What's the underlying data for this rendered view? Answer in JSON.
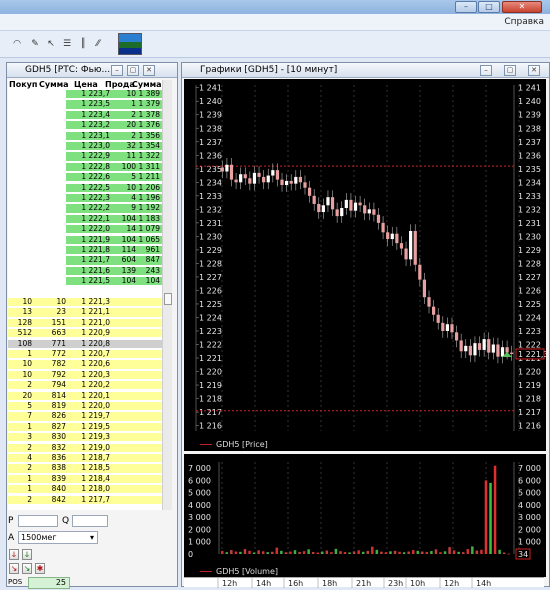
{
  "menu": {
    "help": "Справка"
  },
  "orderbook": {
    "title": "GDH5 [РТС: Фью...",
    "columns": [
      "Покуп",
      "Сумма",
      "Цена",
      "Прода",
      "Сумма"
    ],
    "rows": [
      [
        "",
        "",
        "1 223,7",
        "10",
        "1 389"
      ],
      [
        "",
        "",
        "1 223,5",
        "1",
        "1 379"
      ],
      [
        "",
        "",
        "1 223,4",
        "2",
        "1 378"
      ],
      [
        "",
        "",
        "1 223,2",
        "20",
        "1 376"
      ],
      [
        "",
        "",
        "1 223,1",
        "2",
        "1 356"
      ],
      [
        "",
        "",
        "1 223,0",
        "32",
        "1 354"
      ],
      [
        "",
        "",
        "1 222,9",
        "11",
        "1 322"
      ],
      [
        "",
        "",
        "1 222,8",
        "100",
        "1 311"
      ],
      [
        "",
        "",
        "1 222,6",
        "5",
        "1 211"
      ],
      [
        "",
        "",
        "1 222,5",
        "10",
        "1 206"
      ],
      [
        "",
        "",
        "1 222,3",
        "4",
        "1 196"
      ],
      [
        "",
        "",
        "1 222,2",
        "9",
        "1 192"
      ],
      [
        "",
        "",
        "1 222,1",
        "104",
        "1 183"
      ],
      [
        "",
        "",
        "1 222,0",
        "14",
        "1 079"
      ],
      [
        "",
        "",
        "1 221,9",
        "104",
        "1 065"
      ],
      [
        "",
        "",
        "1 221,8",
        "114",
        "961"
      ],
      [
        "",
        "",
        "1 221,7",
        "604",
        "847"
      ],
      [
        "",
        "",
        "1 221,6",
        "139",
        "243"
      ],
      [
        "",
        "",
        "1 221,5",
        "104",
        "104"
      ],
      [
        "",
        "",
        "",
        "",
        ""
      ],
      [
        "10",
        "10",
        "1 221,3",
        "",
        ""
      ],
      [
        "13",
        "23",
        "1 221,1",
        "",
        ""
      ],
      [
        "128",
        "151",
        "1 221,0",
        "",
        ""
      ],
      [
        "512",
        "663",
        "1 220,9",
        "",
        ""
      ],
      [
        "108",
        "771",
        "1 220,8",
        "",
        ""
      ],
      [
        "1",
        "772",
        "1 220,7",
        "",
        ""
      ],
      [
        "10",
        "782",
        "1 220,6",
        "",
        ""
      ],
      [
        "10",
        "792",
        "1 220,3",
        "",
        ""
      ],
      [
        "2",
        "794",
        "1 220,2",
        "",
        ""
      ],
      [
        "20",
        "814",
        "1 220,1",
        "",
        ""
      ],
      [
        "5",
        "819",
        "1 220,0",
        "",
        ""
      ],
      [
        "7",
        "826",
        "1 219,7",
        "",
        ""
      ],
      [
        "1",
        "827",
        "1 219,5",
        "",
        ""
      ],
      [
        "3",
        "830",
        "1 219,3",
        "",
        ""
      ],
      [
        "2",
        "832",
        "1 219,0",
        "",
        ""
      ],
      [
        "4",
        "836",
        "1 218,7",
        "",
        ""
      ],
      [
        "2",
        "838",
        "1 218,5",
        "",
        ""
      ],
      [
        "1",
        "839",
        "1 218,4",
        "",
        ""
      ],
      [
        "1",
        "840",
        "1 218,0",
        "",
        ""
      ],
      [
        "2",
        "842",
        "1 217,7",
        "",
        ""
      ]
    ],
    "colors": {
      "ask": "#7fe07f",
      "bid": "#ffff99",
      "highlight": "#cfcfcf"
    }
  },
  "controls": {
    "p_label": "P",
    "q_label": "Q",
    "a_label": "A",
    "account": "1500мег",
    "pos_label": "POS",
    "pos_value": "25"
  },
  "chart": {
    "title": "Графики [GDH5] - [10 минут]",
    "price_legend": "GDH5 [Price]",
    "volume_legend": "GDH5 [Volume]",
    "current_price_tag": "1 221,3",
    "current_volume_tag": "34",
    "time_labels": [
      "12h",
      "14h",
      "16h",
      "18h",
      "21h",
      "23h",
      "10h",
      "12h",
      "14h"
    ]
  },
  "chart_data": [
    {
      "type": "candlestick",
      "title": "",
      "ylim": [
        1215.6,
        1241.2
      ],
      "y_ticks": [
        "1 241",
        "1 240",
        "1 239",
        "1 238",
        "1 237",
        "1 236",
        "1 235",
        "1 234",
        "1 233",
        "1 232",
        "1 231",
        "1 230",
        "1 229",
        "1 228",
        "1 227",
        "1 226",
        "1 225",
        "1 224",
        "1 223",
        "1 222",
        "1 221",
        "1 220",
        "1 219",
        "1 218",
        "1 217",
        "1 216"
      ],
      "reference_levels": [
        1235.2,
        1217.1
      ],
      "last_price": 1221.3,
      "close_series": [
        1234.8,
        1235.3,
        1234.2,
        1234.0,
        1234.6,
        1234.3,
        1233.9,
        1234.7,
        1234.4,
        1234.0,
        1234.5,
        1234.9,
        1234.2,
        1233.8,
        1234.1,
        1233.9,
        1234.4,
        1234.0,
        1233.6,
        1233.0,
        1232.4,
        1231.8,
        1232.3,
        1232.9,
        1232.0,
        1231.5,
        1232.1,
        1232.7,
        1231.9,
        1232.5,
        1232.3,
        1231.7,
        1232.0,
        1231.6,
        1231.0,
        1230.3,
        1229.8,
        1230.2,
        1229.5,
        1229.1,
        1228.3,
        1230.4,
        1227.9,
        1226.8,
        1225.5,
        1224.8,
        1224.2,
        1223.6,
        1223.0,
        1223.5,
        1222.9,
        1222.3,
        1221.5,
        1221.9,
        1221.2,
        1222.1,
        1221.6,
        1222.4,
        1221.4,
        1222.0,
        1221.1,
        1221.8,
        1221.4,
        1221.3
      ]
    },
    {
      "type": "bar",
      "title": "",
      "ylim": [
        0,
        7500
      ],
      "y_ticks": [
        "7 000",
        "6 000",
        "5 000",
        "4 000",
        "3 000",
        "2 000",
        "1 000",
        "0"
      ],
      "values": [
        250,
        150,
        320,
        200,
        180,
        400,
        260,
        120,
        300,
        220,
        150,
        180,
        520,
        260,
        140,
        200,
        310,
        170,
        230,
        380,
        160,
        120,
        200,
        280,
        150,
        420,
        230,
        160,
        130,
        210,
        300,
        180,
        250,
        600,
        340,
        190,
        150,
        220,
        260,
        180,
        140,
        200,
        320,
        260,
        200,
        170,
        240,
        380,
        150,
        220,
        560,
        300,
        180,
        150,
        400,
        620,
        280,
        350,
        6000,
        5800,
        7200,
        340,
        120,
        34
      ]
    }
  ]
}
